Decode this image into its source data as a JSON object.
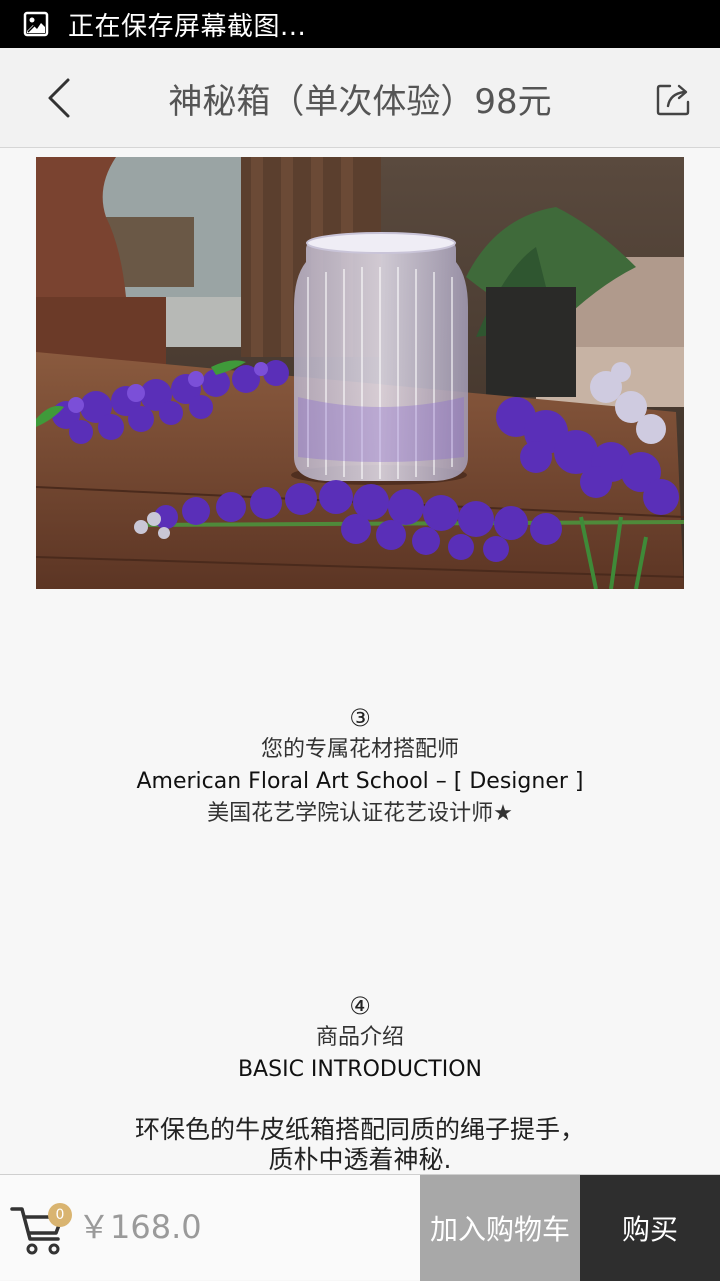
{
  "status_bar": {
    "text": "正在保存屏幕截图...",
    "icon": "screenshot-icon"
  },
  "navbar": {
    "title": "神秘箱（单次体验）98元",
    "back_icon": "back-arrow-icon",
    "share_icon": "share-icon"
  },
  "product_image": {
    "subject": "glass vase with purple delphinium flowers on wooden table"
  },
  "section3": {
    "number": "③",
    "line1": "您的专属花材搭配师",
    "line2": "American Floral Art School  –  [ Designer ]",
    "line3": "美国花艺学院认证花艺设计师★"
  },
  "section4": {
    "number": "④",
    "line1": "商品介绍",
    "line2": "BASIC INTRODUCTION"
  },
  "description": {
    "line1": "环保色的牛皮纸箱搭配同质的绳子提手，",
    "line2": "质朴中透着神秘."
  },
  "bottom_bar": {
    "cart_count": "0",
    "price": "￥168.0",
    "add_to_cart_label": "加入购物车",
    "buy_label": "购买"
  },
  "colors": {
    "status_bar_bg": "#000000",
    "navbar_bg": "#f2f2f2",
    "badge": "#d9b470",
    "add_cart_btn": "#a8a8a8",
    "buy_btn": "#2e2e2e"
  }
}
